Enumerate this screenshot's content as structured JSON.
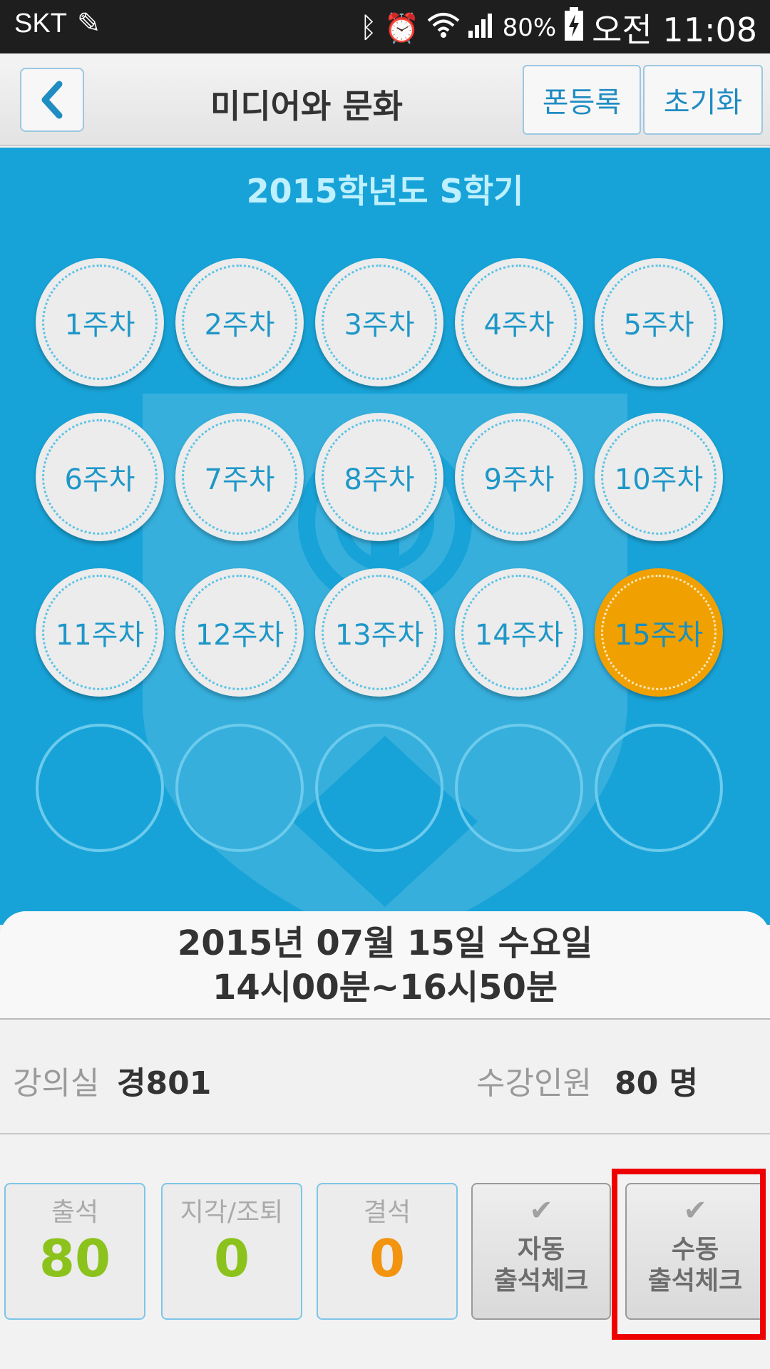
{
  "status_bar": {
    "carrier": "SKT",
    "battery": "80%",
    "time": "오전 11:08",
    "icons": [
      "edit-icon",
      "bluetooth-icon",
      "alarm-icon",
      "wifi-icon",
      "signal-icon",
      "battery-charging-icon"
    ]
  },
  "header": {
    "title": "미디어와 문화",
    "register_label": "폰등록",
    "reset_label": "초기화"
  },
  "semester": "2015학년도 S학기",
  "weeks": [
    {
      "label": "1주차"
    },
    {
      "label": "2주차"
    },
    {
      "label": "3주차"
    },
    {
      "label": "4주차"
    },
    {
      "label": "5주차"
    },
    {
      "label": "6주차"
    },
    {
      "label": "7주차"
    },
    {
      "label": "8주차"
    },
    {
      "label": "9주차"
    },
    {
      "label": "10주차"
    },
    {
      "label": "11주차"
    },
    {
      "label": "12주차"
    },
    {
      "label": "13주차"
    },
    {
      "label": "14주차"
    },
    {
      "label": "15주차",
      "selected": true
    }
  ],
  "session": {
    "date": "2015년 07월 15일 수요일",
    "time": "14시00분~16시50분",
    "room_label": "강의실",
    "room_value": "경801",
    "enrolled_label": "수강인원",
    "enrolled_value": "80 명"
  },
  "stats": {
    "present_label": "출석",
    "present_value": "80",
    "late_label": "지각/조퇴",
    "late_value": "0",
    "absent_label": "결석",
    "absent_value": "0"
  },
  "actions": {
    "auto_check": "자동\n출석체크",
    "manual_check": "수동\n출석체크"
  },
  "colors": {
    "accent_blue": "#18a3d8",
    "selected_week": "#f0a000",
    "present_green": "#8cc21c",
    "late_green": "#8cc21c",
    "absent_orange": "#f29410",
    "highlight_red": "#ee0000"
  }
}
